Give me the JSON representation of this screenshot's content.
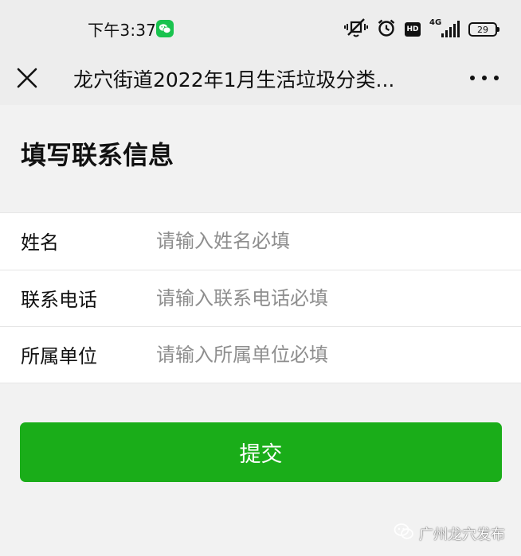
{
  "status_bar": {
    "time": "下午3:37",
    "network": "4G",
    "hd_badge": "HD",
    "battery": "29",
    "icons": [
      "wechat-icon",
      "mute-vibrate-icon",
      "alarm-icon",
      "hd-icon",
      "signal-icon",
      "battery-icon"
    ]
  },
  "navbar": {
    "title": "龙穴街道2022年1月生活垃圾分类...",
    "close_icon": "close-icon",
    "more_icon": "more-icon"
  },
  "page": {
    "title": "填写联系信息"
  },
  "form": {
    "fields": [
      {
        "label": "姓名",
        "placeholder": "请输入姓名必填",
        "value": ""
      },
      {
        "label": "联系电话",
        "placeholder": "请输入联系电话必填",
        "value": ""
      },
      {
        "label": "所属单位",
        "placeholder": "请输入所属单位必填",
        "value": ""
      }
    ],
    "submit_label": "提交"
  },
  "watermark": {
    "text": "广州龙穴发布",
    "icon": "wechat-channel-icon"
  },
  "colors": {
    "primary_green": "#1aad19",
    "background": "#f2f2f2",
    "header_bg": "#ededed",
    "placeholder": "#8e8e8e"
  }
}
